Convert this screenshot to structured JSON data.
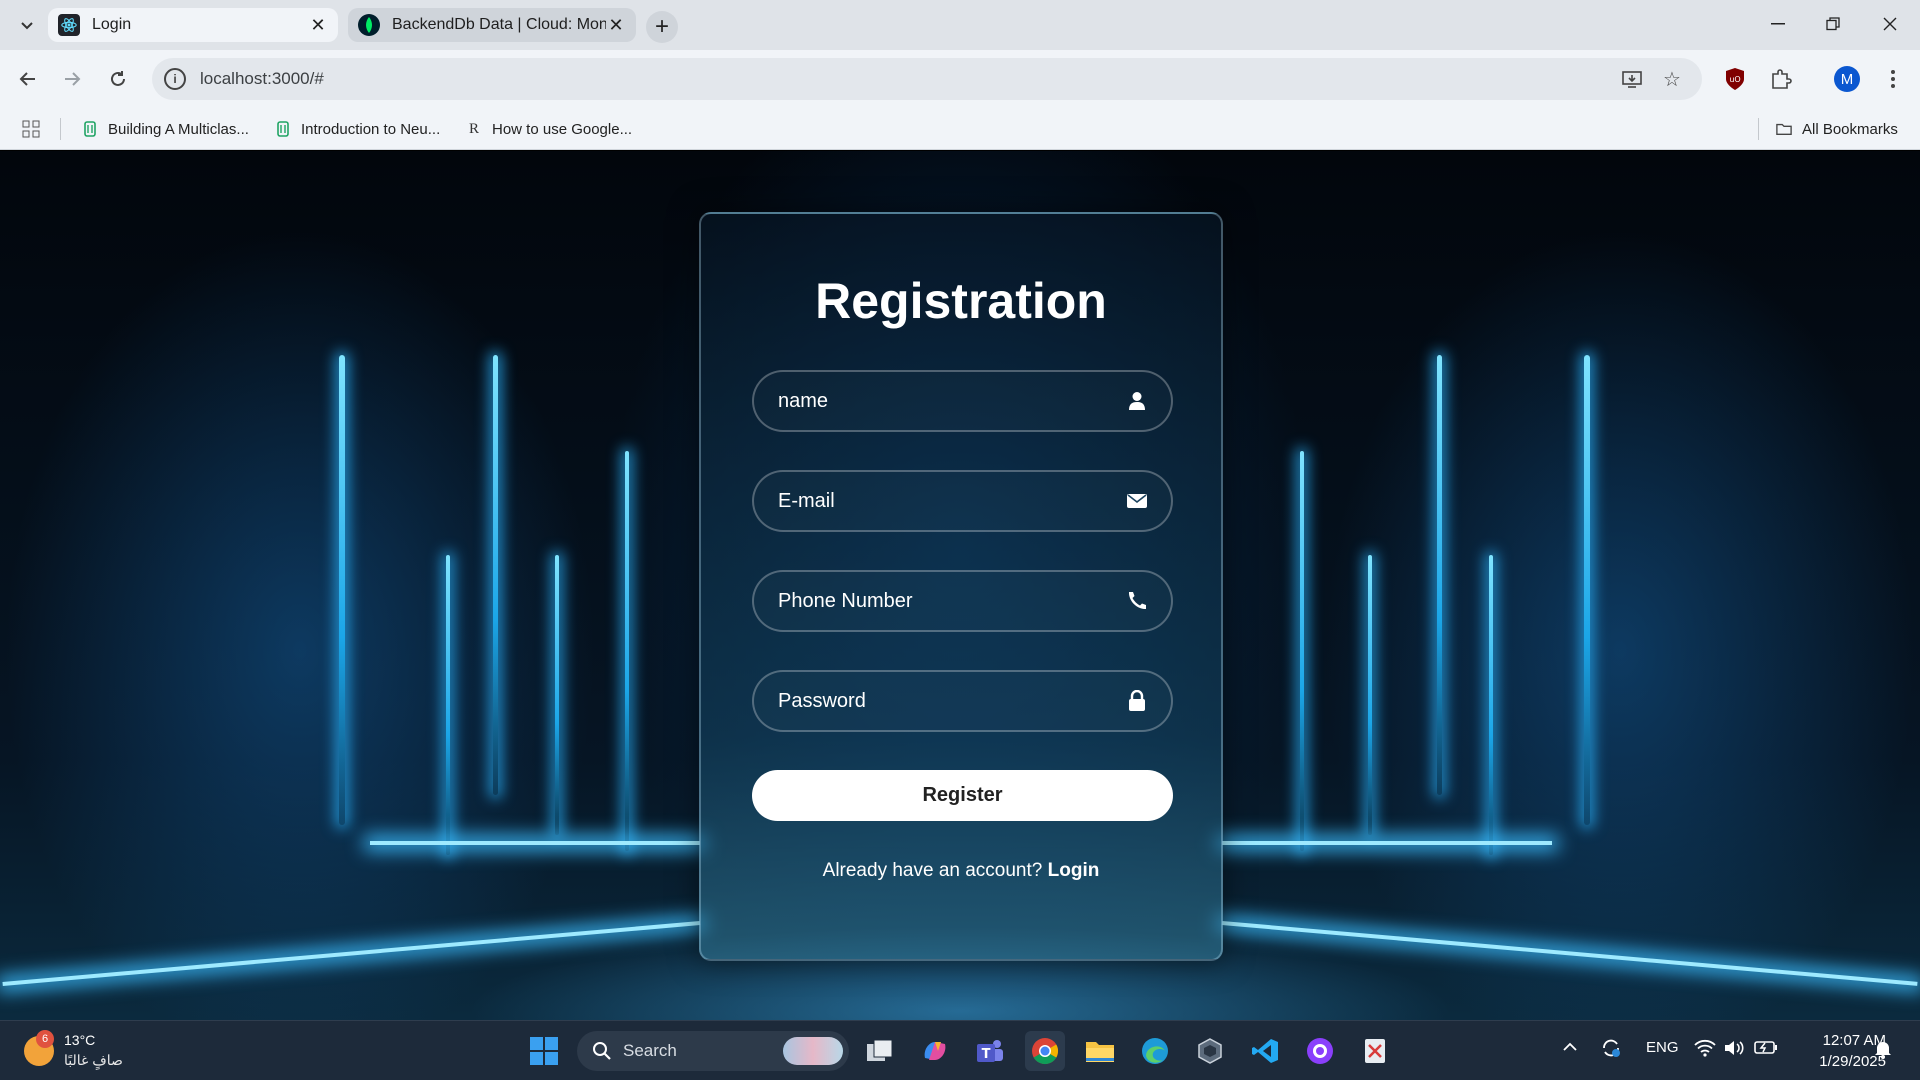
{
  "browser": {
    "tabs": [
      {
        "title": "Login",
        "active": true,
        "icon": "react-icon"
      },
      {
        "title": "BackendDb Data | Cloud: Mong",
        "active": false,
        "icon": "mongodb-leaf-icon"
      }
    ],
    "url": "localhost:3000/#",
    "profile_initial": "M",
    "bookmarks": [
      {
        "label": "Building A Multiclas...",
        "icon": "bookmark-doc-icon"
      },
      {
        "label": "Introduction to Neu...",
        "icon": "bookmark-doc-icon"
      },
      {
        "label": "How to use Google...",
        "icon": "r-logo-icon"
      }
    ],
    "all_bookmarks_label": "All Bookmarks"
  },
  "form": {
    "title": "Registration",
    "fields": [
      {
        "placeholder": "name",
        "icon": "user-icon"
      },
      {
        "placeholder": "E-mail",
        "icon": "envelope-icon"
      },
      {
        "placeholder": "Phone Number",
        "icon": "phone-icon"
      },
      {
        "placeholder": "Password",
        "icon": "lock-icon"
      }
    ],
    "register_label": "Register",
    "login_prompt": "Already have an account?",
    "login_link": "Login"
  },
  "taskbar": {
    "weather": {
      "temp": "13°C",
      "condition": "صافٍ غالبًا",
      "badge": "6"
    },
    "search_label": "Search",
    "language": "ENG",
    "time": "12:07 AM",
    "date": "1/29/2025"
  },
  "colors": {
    "accent": "#1ba6e8",
    "card_border": "#b4dcf0"
  }
}
